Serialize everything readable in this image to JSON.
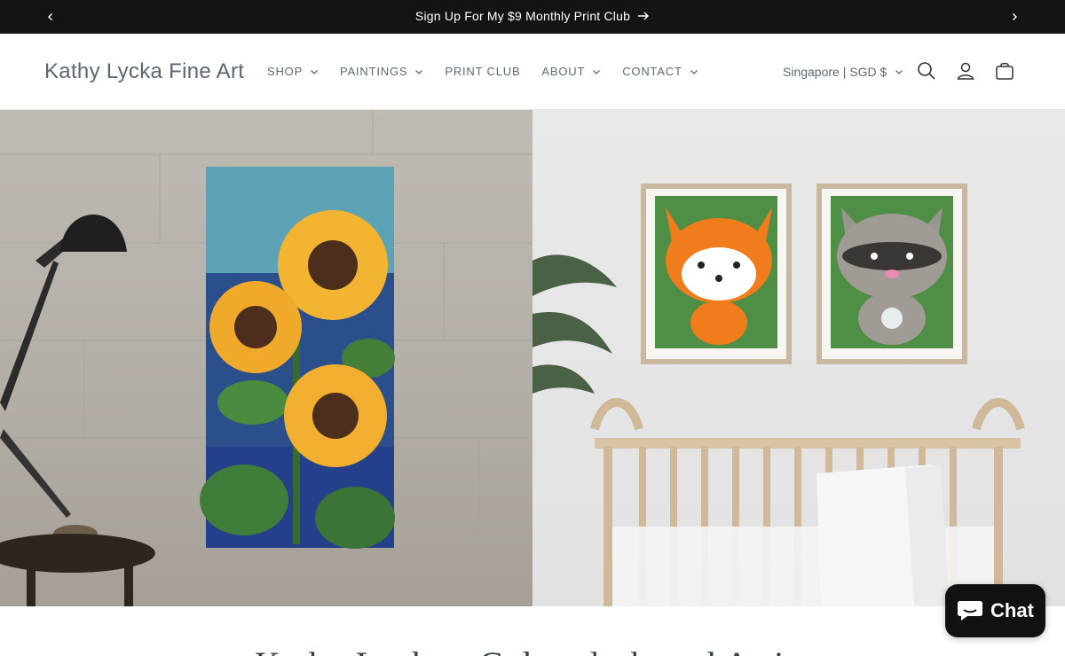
{
  "announcement": {
    "text": "Sign Up For My $9 Monthly Print Club"
  },
  "header": {
    "logo": "Kathy Lycka Fine Art",
    "nav": [
      {
        "label": "SHOP"
      },
      {
        "label": "PAINTINGS"
      },
      {
        "label": "PRINT CLUB"
      },
      {
        "label": "ABOUT"
      },
      {
        "label": "CONTACT"
      }
    ],
    "locale": "Singapore | SGD $"
  },
  "hero": {
    "left_alt": "Sunflower stained-glass style painting on wall",
    "right_alt": "Fox and raccoon nursery prints above crib"
  },
  "section": {
    "title": "Kathy Lycka - Colorado-based Artist"
  },
  "chat": {
    "label": "Chat"
  },
  "colors": {
    "announce_bg": "#141414",
    "nav_text": "#5d6870",
    "chat_bg": "#111111"
  },
  "icons": [
    "chevron-left-icon",
    "arrow-right-icon",
    "chevron-right-icon",
    "chevron-down-icon",
    "search-icon",
    "account-icon",
    "cart-icon",
    "chat-bubble-icon"
  ]
}
